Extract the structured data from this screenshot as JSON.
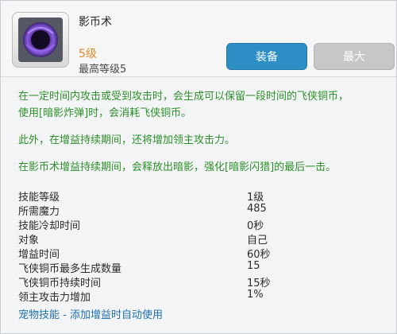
{
  "skill": {
    "name": "影币术",
    "level": "5级",
    "max_level": "最高等级5",
    "icon": "shadow-orb-icon"
  },
  "buttons": {
    "equip": "装备",
    "max": "最大"
  },
  "description": {
    "line1": "在一定时间内攻击或受到攻击时，会生成可以保留一段时间的飞侠铜币，",
    "line2": "使用[暗影炸弹]时，会消耗飞侠铜币。",
    "line3": "此外，在增益持续期间，还将增加领主攻击力。",
    "line4": "在影币术增益持续期间，会释放出暗影，强化[暗影闪猎]的最后一击。"
  },
  "stats": [
    {
      "label": "技能等级",
      "value": "1级"
    },
    {
      "label": "所需魔力",
      "value": "485"
    },
    {
      "label": "技能冷却时间",
      "value": "0秒"
    },
    {
      "label": "对象",
      "value": "自己"
    },
    {
      "label": "增益时间",
      "value": "60秒"
    },
    {
      "label": "飞侠铜币最多生成数量",
      "value": "15"
    },
    {
      "label": "飞侠铜币持续时间",
      "value": "15秒"
    },
    {
      "label": "领主攻击力增加",
      "value": "1%"
    }
  ],
  "footer": {
    "link": "宠物技能 - 添加增益时自动使用"
  },
  "colors": {
    "accent": "#2d8ec6",
    "description_text": "#2e8f2a",
    "level_text": "#e08a2c",
    "link": "#1f6fb0"
  }
}
